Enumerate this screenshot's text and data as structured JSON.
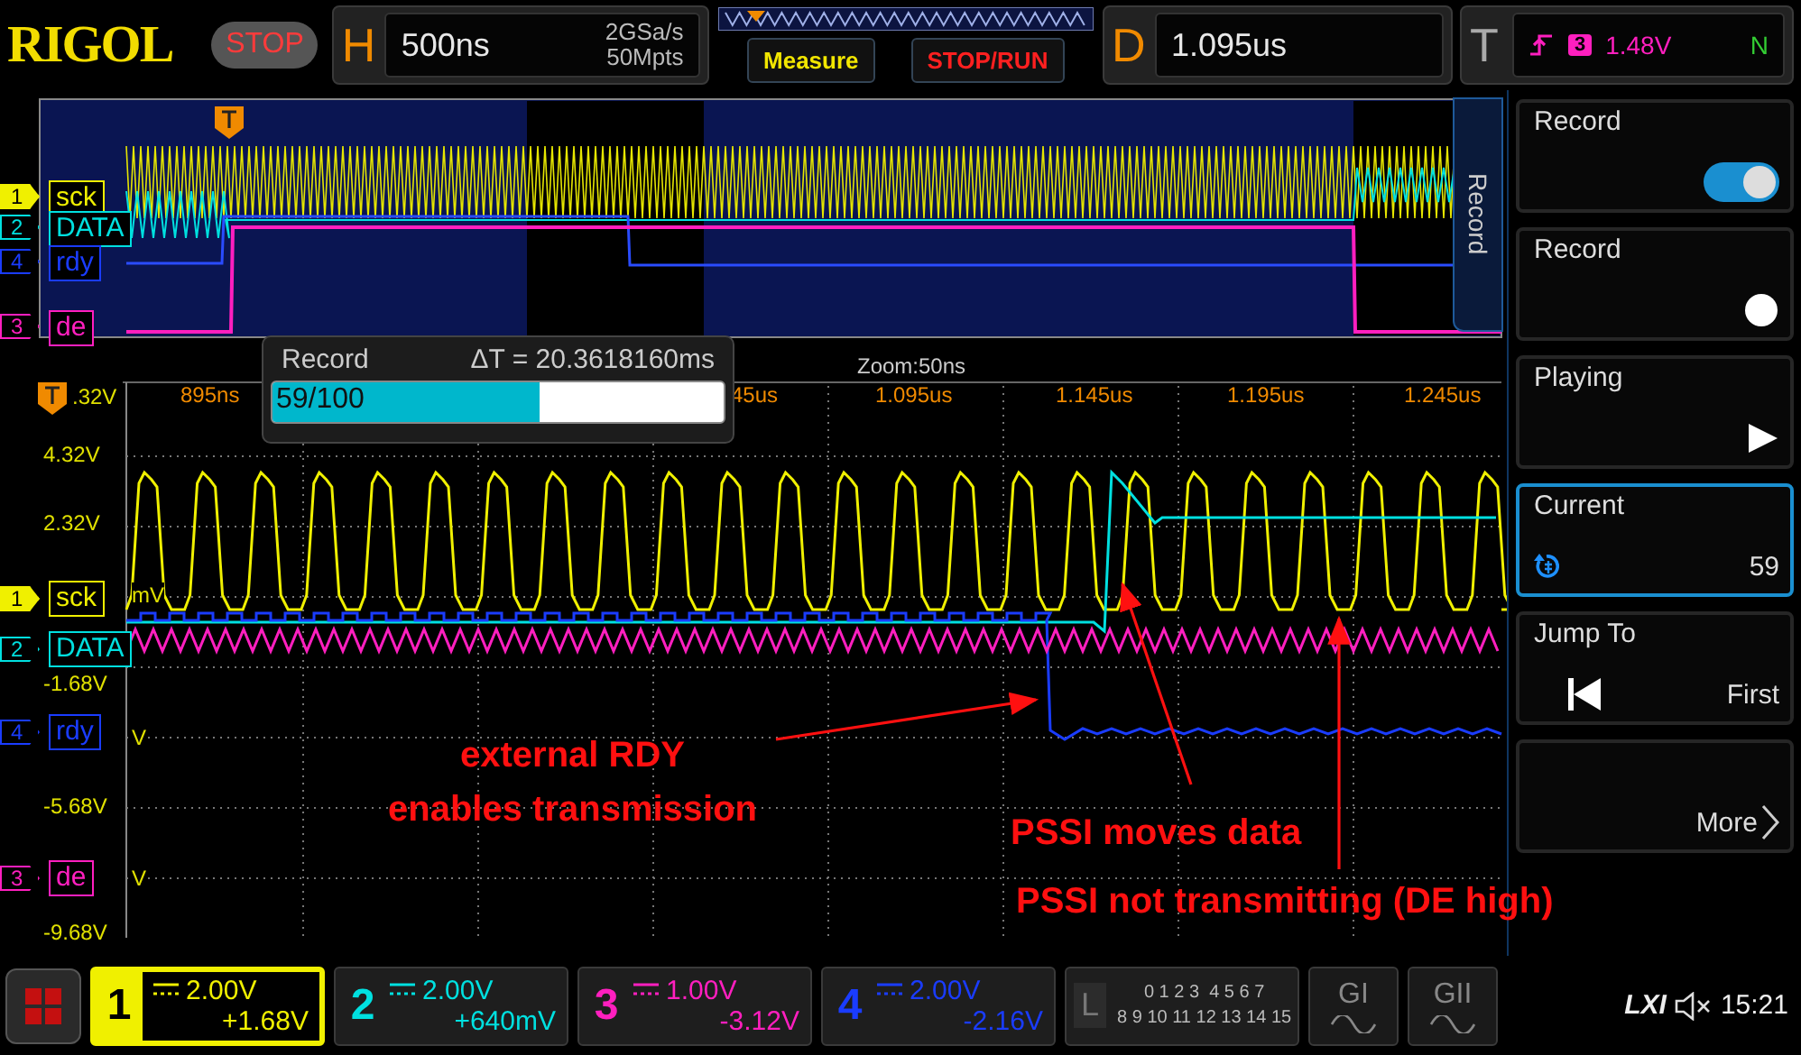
{
  "header": {
    "logo": "RIGOL",
    "run_state": "STOP",
    "horizontal": {
      "label": "H",
      "timebase": "500ns",
      "sample_rate": "2GSa/s",
      "memory_depth": "50Mpts"
    },
    "buttons": [
      "Measure",
      "STOP/RUN"
    ],
    "delay": {
      "label": "D",
      "value": "1.095us"
    },
    "trigger": {
      "label": "T",
      "source": "3",
      "level": "1.48V",
      "mode": "N"
    }
  },
  "overview": {
    "channels": [
      {
        "number": "1",
        "name": "sck",
        "color": "#f0f000"
      },
      {
        "number": "2",
        "name": "DATA",
        "color": "#00e0e0"
      },
      {
        "number": "4",
        "name": "rdy",
        "color": "#1a3cff"
      },
      {
        "number": "3",
        "name": "de",
        "color": "#ff1fbf"
      }
    ]
  },
  "zoom_view": {
    "title": "Zoom:50ns",
    "time_labels": [
      "895ns",
      "45us",
      "1.095us",
      "1.145us",
      "1.195us",
      "1.245us"
    ],
    "voltage_labels": [
      ".32V",
      "4.32V",
      "2.32V",
      "mV",
      "-1.68V",
      "V",
      "-5.68V",
      "V",
      "-9.68V"
    ],
    "channels": [
      {
        "number": "1",
        "name": "sck",
        "color": "#f0f000"
      },
      {
        "number": "2",
        "name": "DATA",
        "color": "#00e0e0"
      },
      {
        "number": "4",
        "name": "rdy",
        "color": "#1a3cff"
      },
      {
        "number": "3",
        "name": "de",
        "color": "#ff1fbf"
      }
    ]
  },
  "record_popup": {
    "title": "Record",
    "delta": "ΔT = 20.3618160ms",
    "progress": "59/100",
    "level": 0.59
  },
  "annotations": [
    "external RDY\nenables transmission",
    "PSSI moves data",
    "PSSI not transmitting (DE high)"
  ],
  "side_panel": {
    "tab": "Record",
    "softkeys": [
      {
        "kind": "toggle",
        "label": "Record",
        "on": true,
        "selected": false
      },
      {
        "kind": "record",
        "label": "Record",
        "selected": false
      },
      {
        "kind": "play",
        "label": "Playing",
        "selected": false
      },
      {
        "kind": "counter",
        "label": "Current",
        "value": "59",
        "selected": true
      },
      {
        "kind": "jump",
        "label": "Jump To",
        "value": "First",
        "selected": false
      },
      {
        "kind": "more",
        "value": "More",
        "selected": false
      }
    ]
  },
  "bottom_bar": {
    "channels": [
      {
        "number": "1",
        "scale": "2.00V",
        "offset": "+1.68V",
        "selected": true
      },
      {
        "number": "2",
        "scale": "2.00V",
        "offset": "+640mV",
        "selected": false
      },
      {
        "number": "3",
        "scale": "1.00V",
        "offset": "-3.12V",
        "selected": false
      },
      {
        "number": "4",
        "scale": "2.00V",
        "offset": "-2.16V",
        "selected": false
      }
    ],
    "logic": {
      "label": "L",
      "rows": [
        "0 1 2 3  4 5 6 7",
        "8 9 10 11 12 13 14 15"
      ]
    },
    "bus_buttons": [
      "GI",
      "GII"
    ],
    "lxi": "LXI",
    "time": "15:21"
  }
}
